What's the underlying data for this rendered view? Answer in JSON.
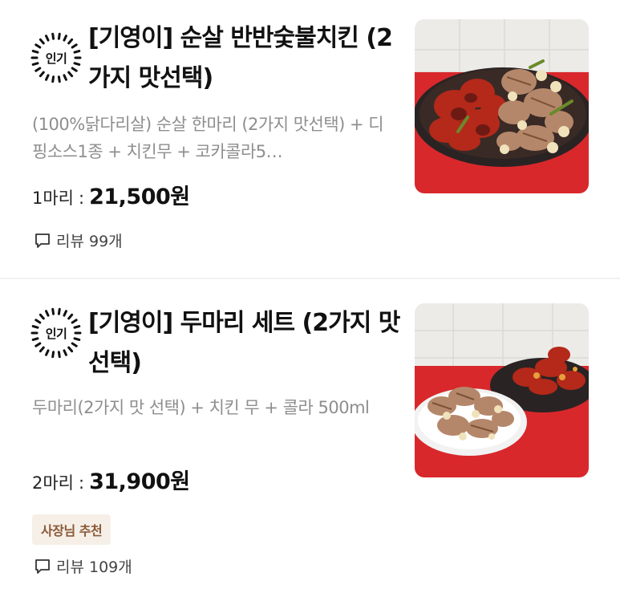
{
  "items": [
    {
      "badge": "인기",
      "title": "[기영이] 순살 반반숯불치킨 (2가지 맛선택)",
      "description": "(100%닭다리살) 순살 한마리 (2가지 맛선택) + 디핑소스1종 + 치킨무 + 코카콜라5…",
      "quantity": "1마리",
      "price": "21,500원",
      "review_label": "리뷰 99개",
      "image_icon": "boneless-chicken-plate-photo"
    },
    {
      "badge": "인기",
      "title": "[기영이] 두마리 세트 (2가지 맛 선택)",
      "description": "두마리(2가지 맛 선택) + 치킨 무 + 콜라 500ml",
      "quantity": "2마리",
      "price": "31,900원",
      "tag": "사장님 추천",
      "review_label": "리뷰 109개",
      "image_icon": "two-chicken-plates-photo"
    }
  ],
  "colors": {
    "price": "#111111",
    "description": "#8e8e8e",
    "tag_bg": "#f6efe8",
    "tag_text": "#8a5a37",
    "photo_red": "#d8282c"
  }
}
